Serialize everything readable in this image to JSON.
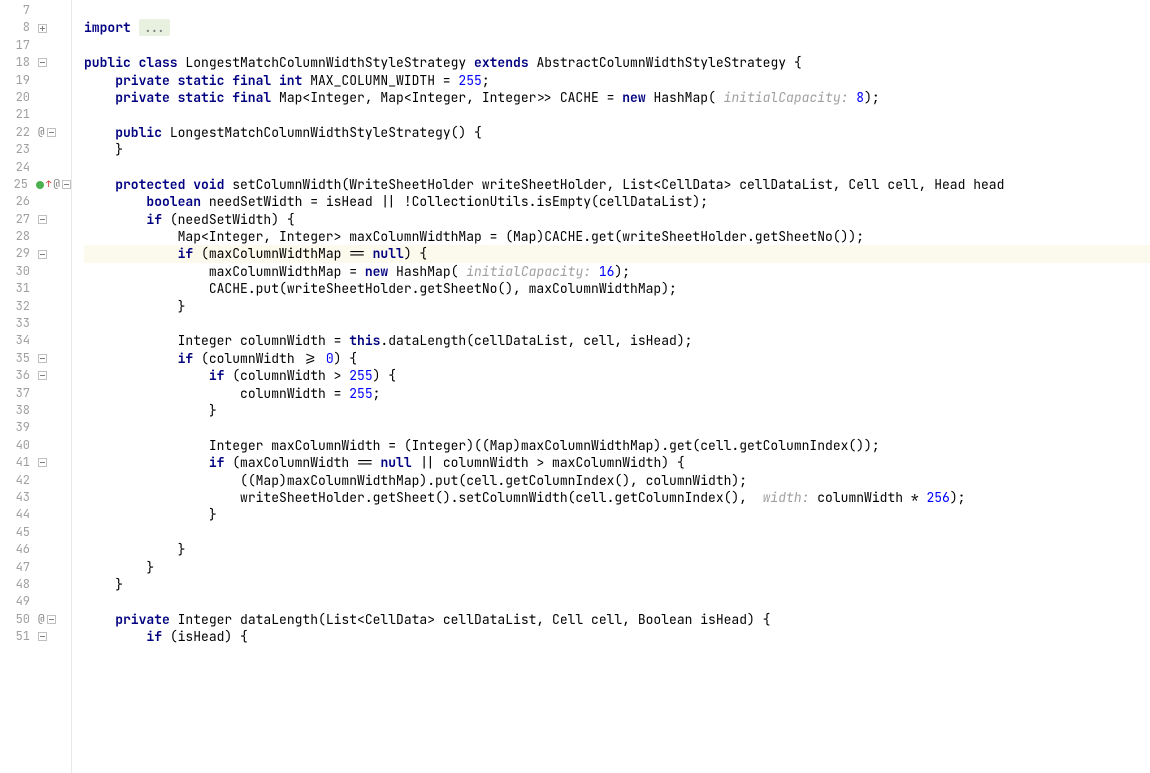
{
  "lines": [
    {
      "n": 7,
      "marks": [],
      "html": ""
    },
    {
      "n": 8,
      "marks": [
        "plus"
      ],
      "html": "<span class='kw'>import</span> <span class='folded'>...</span>"
    },
    {
      "n": 17,
      "marks": [],
      "html": ""
    },
    {
      "n": 18,
      "marks": [
        "minus"
      ],
      "html": "<span class='kw'>public class</span> <span class='txt'>LongestMatchColumnWidthStyleStrategy </span><span class='kw'>extends</span><span class='txt'> AbstractColumnWidthStyleStrategy {</span>"
    },
    {
      "n": 19,
      "marks": [],
      "html": "    <span class='kw'>private static final int</span><span class='txt'> MAX_COLUMN_WIDTH = </span><span class='num'>255</span><span class='txt'>;</span>"
    },
    {
      "n": 20,
      "marks": [],
      "html": "    <span class='kw'>private static final</span><span class='txt'> Map&lt;Integer, Map&lt;Integer, Integer&gt;&gt; CACHE = </span><span class='kw'>new</span><span class='txt'> HashMap( </span><span class='hint'>initialCapacity:</span><span class='txt'> </span><span class='num'>8</span><span class='txt'>);</span>"
    },
    {
      "n": 21,
      "marks": [],
      "html": ""
    },
    {
      "n": 22,
      "marks": [
        "at",
        "minus"
      ],
      "html": "    <span class='kw'>public</span><span class='txt'> LongestMatchColumnWidthStyleStrategy() {</span>"
    },
    {
      "n": 23,
      "marks": [],
      "html": "    <span class='txt'>}</span>"
    },
    {
      "n": 24,
      "marks": [],
      "html": ""
    },
    {
      "n": 25,
      "marks": [
        "green",
        "red",
        "at",
        "minus"
      ],
      "html": "    <span class='kw'>protected void</span><span class='txt'> setColumnWidth(WriteSheetHolder writeSheetHolder, List&lt;CellData&gt; cellDataList, Cell cell, Head head</span>"
    },
    {
      "n": 26,
      "marks": [],
      "html": "        <span class='kw'>boolean</span><span class='txt'> needSetWidth = isHead || !CollectionUtils.isEmpty(cellDataList);</span>"
    },
    {
      "n": 27,
      "marks": [
        "minus"
      ],
      "html": "        <span class='kw'>if</span><span class='txt'> (needSetWidth) {</span>"
    },
    {
      "n": 28,
      "marks": [],
      "html": "            <span class='txt'>Map&lt;Integer, Integer&gt; maxColumnWidthMap = (Map)CACHE.get(writeSheetHolder.getSheetNo());</span>"
    },
    {
      "n": 29,
      "marks": [
        "minus"
      ],
      "hl": true,
      "html": "            <span class='kw'>if</span><span class='txt'> (maxColumnWidthMap == </span><span class='kw'>null</span><span class='txt'>) {</span>"
    },
    {
      "n": 30,
      "marks": [],
      "html": "                <span class='txt'>maxColumnWidthMap = </span><span class='kw'>new</span><span class='txt'> HashMap( </span><span class='hint'>initialCapacity:</span><span class='txt'> </span><span class='num'>16</span><span class='txt'>);</span>"
    },
    {
      "n": 31,
      "marks": [],
      "html": "                <span class='txt'>CACHE.put(writeSheetHolder.getSheetNo(), maxColumnWidthMap);</span>"
    },
    {
      "n": 32,
      "marks": [],
      "html": "            <span class='txt'>}</span>"
    },
    {
      "n": 33,
      "marks": [],
      "html": ""
    },
    {
      "n": 34,
      "marks": [],
      "html": "            <span class='txt'>Integer columnWidth = </span><span class='kw'>this</span><span class='txt'>.dataLength(cellDataList, cell, isHead);</span>"
    },
    {
      "n": 35,
      "marks": [
        "minus"
      ],
      "html": "            <span class='kw'>if</span><span class='txt'> (columnWidth &gt;= </span><span class='num'>0</span><span class='txt'>) {</span>"
    },
    {
      "n": 36,
      "marks": [
        "minus"
      ],
      "html": "                <span class='kw'>if</span><span class='txt'> (columnWidth &gt; </span><span class='num'>255</span><span class='txt'>) {</span>"
    },
    {
      "n": 37,
      "marks": [],
      "html": "                    <span class='txt'>columnWidth = </span><span class='num'>255</span><span class='txt'>;</span>"
    },
    {
      "n": 38,
      "marks": [],
      "html": "                <span class='txt'>}</span>"
    },
    {
      "n": 39,
      "marks": [],
      "html": ""
    },
    {
      "n": 40,
      "marks": [],
      "html": "                <span class='txt'>Integer maxColumnWidth = (Integer)((Map)maxColumnWidthMap).get(cell.getColumnIndex());</span>"
    },
    {
      "n": 41,
      "marks": [
        "minus"
      ],
      "html": "                <span class='kw'>if</span><span class='txt'> (maxColumnWidth == </span><span class='kw'>null</span><span class='txt'> || columnWidth &gt; maxColumnWidth) {</span>"
    },
    {
      "n": 42,
      "marks": [],
      "html": "                    <span class='txt'>((Map)maxColumnWidthMap).put(cell.getColumnIndex(), columnWidth);</span>"
    },
    {
      "n": 43,
      "marks": [],
      "html": "                    <span class='txt'>writeSheetHolder.getSheet().setColumnWidth(cell.getColumnIndex(),  </span><span class='hint'>width:</span><span class='txt'> columnWidth * </span><span class='num'>256</span><span class='txt'>);</span>"
    },
    {
      "n": 44,
      "marks": [],
      "html": "                <span class='txt'>}</span>"
    },
    {
      "n": 45,
      "marks": [],
      "html": ""
    },
    {
      "n": 46,
      "marks": [],
      "html": "            <span class='txt'>}</span>"
    },
    {
      "n": 47,
      "marks": [],
      "html": "        <span class='txt'>}</span>"
    },
    {
      "n": 48,
      "marks": [],
      "html": "    <span class='txt'>}</span>"
    },
    {
      "n": 49,
      "marks": [],
      "html": ""
    },
    {
      "n": 50,
      "marks": [
        "at",
        "minus"
      ],
      "html": "    <span class='kw'>private</span><span class='txt'> Integer dataLength(List&lt;CellData&gt; cellDataList, Cell cell, Boolean isHead) {</span>"
    },
    {
      "n": 51,
      "marks": [
        "minus"
      ],
      "html": "        <span class='kw'>if</span><span class='txt'> (isHead) {</span>"
    }
  ]
}
